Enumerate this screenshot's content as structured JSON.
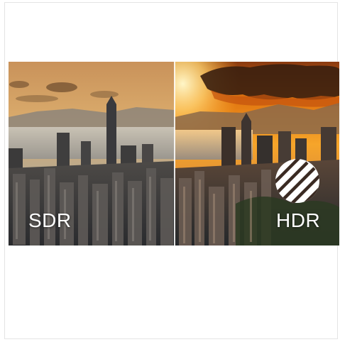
{
  "comparison": {
    "left_label": "SDR",
    "right_label": "HDR",
    "badge_icon": "hdr-stripe-logo-icon",
    "colors": {
      "sdr_sky": "#d9a25e",
      "hdr_sky": "#f08a16",
      "hdr_cloud": "#3a1f10",
      "water": "#b9b6b1",
      "city": "#2f3136"
    }
  }
}
